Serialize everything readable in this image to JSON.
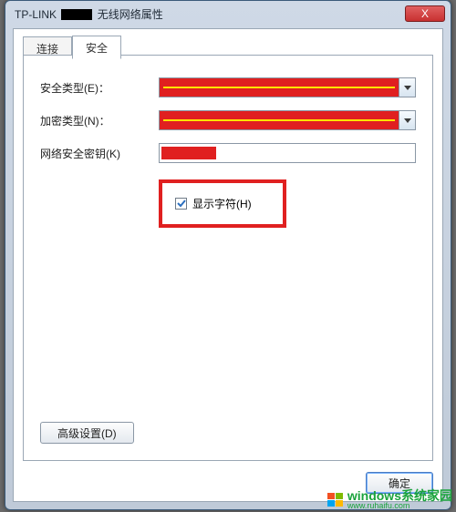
{
  "window": {
    "title_prefix": "TP-LINK",
    "title_suffix": "无线网络属性",
    "close_glyph": "X"
  },
  "tabs": {
    "connect": "连接",
    "security": "安全"
  },
  "fields": {
    "security_type_label": "安全类型(E)：",
    "encryption_type_label": "加密类型(N)：",
    "network_key_label": "网络安全密钥(K)"
  },
  "checkbox": {
    "show_chars_label": "显示字符(H)",
    "checked": true
  },
  "buttons": {
    "advanced": "高级设置(D)",
    "ok": "确定"
  },
  "watermark": {
    "line1": "windows系统家园",
    "line2": "www.ruhaifu.com"
  }
}
